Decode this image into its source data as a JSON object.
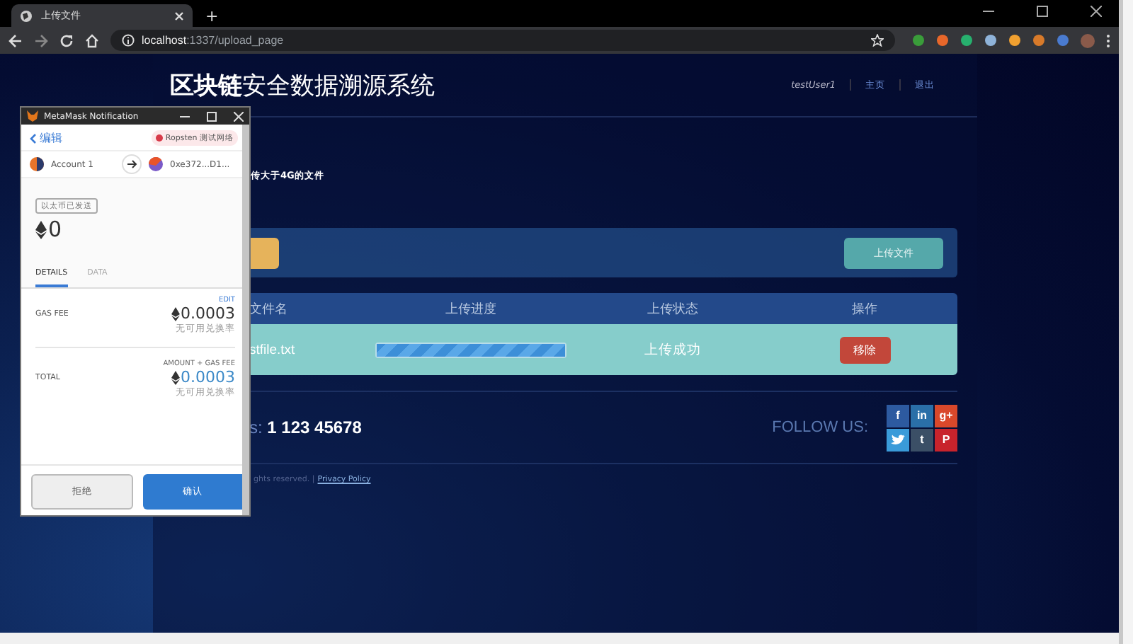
{
  "browser": {
    "tabs": [
      {
        "label": "上传文件",
        "selected": true
      }
    ],
    "new_tab": "+",
    "address_host": "localhost",
    "address_path": ":1337/upload_page"
  },
  "page": {
    "title": "**区块链**安全数据溯源系统",
    "nav": [
      {
        "label": "testUser1",
        "kind": "user"
      },
      {
        "label": "主页",
        "kind": "link"
      },
      {
        "label": "退出",
        "kind": "link"
      }
    ],
    "notice": "传大于4G的文件",
    "upload_button": "上传文件",
    "table": {
      "columns": [
        "文件名",
        "上传进度",
        "上传状态",
        "操作"
      ],
      "rows": [
        {
          "file": "stfile.txt",
          "level": 1,
          "status": "上传成功",
          "action": "移除"
        }
      ]
    },
    "contact": "s: **1 123 45678**",
    "follow": "FOLLOW US:",
    "social": [
      {
        "kind": "glyph",
        "glyph": "f",
        "color": "#2d5aa0"
      },
      {
        "kind": "glyph",
        "glyph": "in",
        "color": "#2a6fa8"
      },
      {
        "kind": "glyph",
        "glyph": "g+",
        "color": "#d9482b"
      },
      {
        "kind": "bird",
        "color": "#3a9bd9"
      },
      {
        "kind": "glyph",
        "glyph": "t",
        "color": "#3b4f66"
      },
      {
        "kind": "glyph",
        "glyph": "P",
        "color": "#c8232c"
      }
    ],
    "copyright": "ghts reserved. |",
    "privacy": "Privacy Policy"
  },
  "metamask": {
    "title": "MetaMask Notification",
    "back": "编辑",
    "network": "Ropsten 测试网络",
    "from": "Account 1",
    "to": "0xe372...D1...",
    "tag": "以太币已发送",
    "amount": "0",
    "tabs": [
      {
        "label": "DETAILS",
        "selected": true
      },
      {
        "label": "DATA",
        "selected": false
      }
    ],
    "edit": "EDIT",
    "rows": [
      {
        "label": "GAS FEE",
        "hint": "",
        "value": "0.0003",
        "note": "无可用兑换率",
        "kind": "plain"
      },
      {
        "label": "TOTAL",
        "hint": "AMOUNT + GAS FEE",
        "value": "0.0003",
        "note": "无可用兑换率",
        "kind": "accent"
      }
    ],
    "buttons": [
      {
        "label": "拒绝",
        "kind": "secondary"
      },
      {
        "label": "确认",
        "kind": "primary"
      }
    ]
  }
}
